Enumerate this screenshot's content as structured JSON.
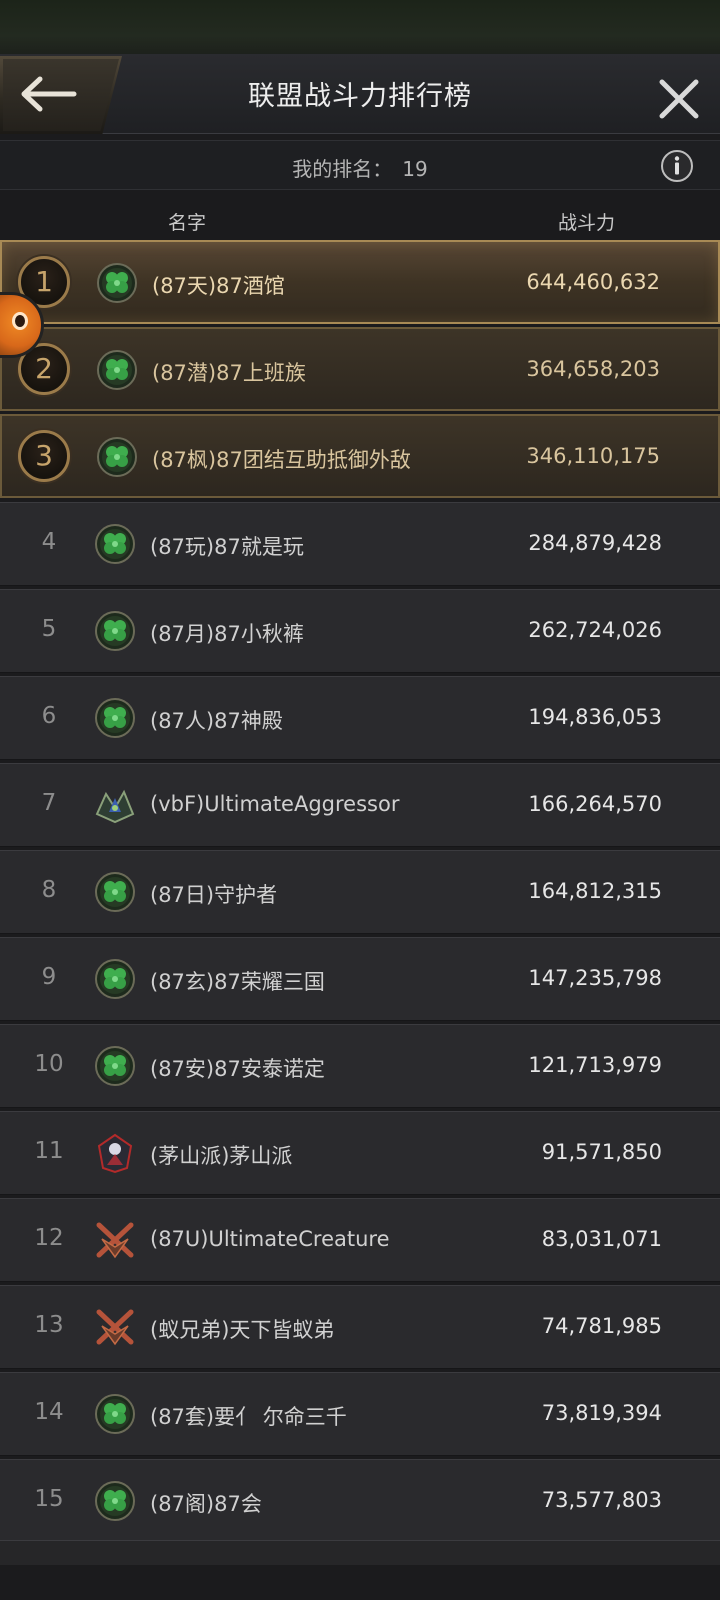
{
  "header": {
    "title": "联盟战斗力排行榜",
    "back_icon": "left-arrow-icon",
    "close_icon": "close-icon"
  },
  "my_rank": {
    "label": "我的排名：",
    "value": "19",
    "info_icon": "info-icon"
  },
  "columns": {
    "name": "名字",
    "power": "战斗力"
  },
  "colors": {
    "accent_gold": "#a88a55",
    "row_bg": "#2a2a2d",
    "emblem_green": "#3fae4e"
  },
  "rows": [
    {
      "rank": "1",
      "emblem": "clover-emblem",
      "name": "(87天)87酒馆",
      "power": "644,460,632"
    },
    {
      "rank": "2",
      "emblem": "clover-emblem",
      "name": "(87潜)87上班族",
      "power": "364,658,203"
    },
    {
      "rank": "3",
      "emblem": "clover-emblem",
      "name": "(87枫)87团结互助抵御外敌",
      "power": "346,110,175"
    },
    {
      "rank": "4",
      "emblem": "clover-emblem",
      "name": "(87玩)87就是玩",
      "power": "284,879,428"
    },
    {
      "rank": "5",
      "emblem": "clover-emblem",
      "name": "(87月)87小秋裤",
      "power": "262,724,026"
    },
    {
      "rank": "6",
      "emblem": "clover-emblem",
      "name": "(87人)87神殿",
      "power": "194,836,053"
    },
    {
      "rank": "7",
      "emblem": "dragon-emblem",
      "name": "(vbF)UltimateAggressor",
      "power": "166,264,570"
    },
    {
      "rank": "8",
      "emblem": "clover-emblem",
      "name": "(87日)守护者",
      "power": "164,812,315"
    },
    {
      "rank": "9",
      "emblem": "clover-emblem",
      "name": "(87玄)87荣耀三国",
      "power": "147,235,798"
    },
    {
      "rank": "10",
      "emblem": "clover-emblem",
      "name": "(87安)87安泰诺定",
      "power": "121,713,979"
    },
    {
      "rank": "11",
      "emblem": "knight-emblem",
      "name": "(茅山派)茅山派",
      "power": "91,571,850"
    },
    {
      "rank": "12",
      "emblem": "crossed-swords-emblem",
      "name": "(87U)UltimateCreature",
      "power": "83,031,071"
    },
    {
      "rank": "13",
      "emblem": "crossed-swords-emblem",
      "name": "(蚁兄弟)天下皆蚁弟",
      "power": "74,781,985"
    },
    {
      "rank": "14",
      "emblem": "clover-emblem",
      "name": "(87套)要亻 尔命三千",
      "power": "73,819,394"
    },
    {
      "rank": "15",
      "emblem": "clover-emblem",
      "name": "(87阁)87会",
      "power": "73,577,803"
    }
  ]
}
